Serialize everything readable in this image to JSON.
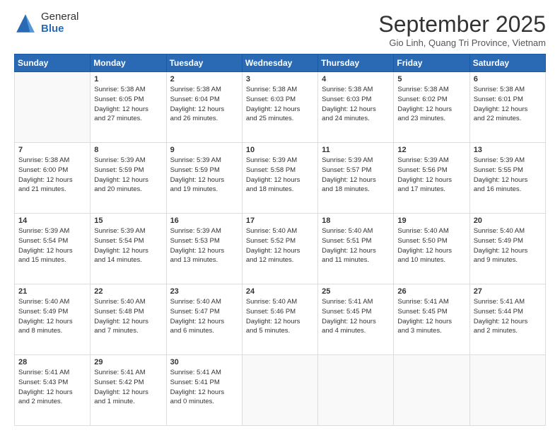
{
  "logo": {
    "general": "General",
    "blue": "Blue"
  },
  "header": {
    "title": "September 2025",
    "subtitle": "Gio Linh, Quang Tri Province, Vietnam"
  },
  "days": [
    "Sunday",
    "Monday",
    "Tuesday",
    "Wednesday",
    "Thursday",
    "Friday",
    "Saturday"
  ],
  "weeks": [
    [
      {
        "num": "",
        "info": ""
      },
      {
        "num": "1",
        "info": "Sunrise: 5:38 AM\nSunset: 6:05 PM\nDaylight: 12 hours\nand 27 minutes."
      },
      {
        "num": "2",
        "info": "Sunrise: 5:38 AM\nSunset: 6:04 PM\nDaylight: 12 hours\nand 26 minutes."
      },
      {
        "num": "3",
        "info": "Sunrise: 5:38 AM\nSunset: 6:03 PM\nDaylight: 12 hours\nand 25 minutes."
      },
      {
        "num": "4",
        "info": "Sunrise: 5:38 AM\nSunset: 6:03 PM\nDaylight: 12 hours\nand 24 minutes."
      },
      {
        "num": "5",
        "info": "Sunrise: 5:38 AM\nSunset: 6:02 PM\nDaylight: 12 hours\nand 23 minutes."
      },
      {
        "num": "6",
        "info": "Sunrise: 5:38 AM\nSunset: 6:01 PM\nDaylight: 12 hours\nand 22 minutes."
      }
    ],
    [
      {
        "num": "7",
        "info": "Sunrise: 5:38 AM\nSunset: 6:00 PM\nDaylight: 12 hours\nand 21 minutes."
      },
      {
        "num": "8",
        "info": "Sunrise: 5:39 AM\nSunset: 5:59 PM\nDaylight: 12 hours\nand 20 minutes."
      },
      {
        "num": "9",
        "info": "Sunrise: 5:39 AM\nSunset: 5:59 PM\nDaylight: 12 hours\nand 19 minutes."
      },
      {
        "num": "10",
        "info": "Sunrise: 5:39 AM\nSunset: 5:58 PM\nDaylight: 12 hours\nand 18 minutes."
      },
      {
        "num": "11",
        "info": "Sunrise: 5:39 AM\nSunset: 5:57 PM\nDaylight: 12 hours\nand 18 minutes."
      },
      {
        "num": "12",
        "info": "Sunrise: 5:39 AM\nSunset: 5:56 PM\nDaylight: 12 hours\nand 17 minutes."
      },
      {
        "num": "13",
        "info": "Sunrise: 5:39 AM\nSunset: 5:55 PM\nDaylight: 12 hours\nand 16 minutes."
      }
    ],
    [
      {
        "num": "14",
        "info": "Sunrise: 5:39 AM\nSunset: 5:54 PM\nDaylight: 12 hours\nand 15 minutes."
      },
      {
        "num": "15",
        "info": "Sunrise: 5:39 AM\nSunset: 5:54 PM\nDaylight: 12 hours\nand 14 minutes."
      },
      {
        "num": "16",
        "info": "Sunrise: 5:39 AM\nSunset: 5:53 PM\nDaylight: 12 hours\nand 13 minutes."
      },
      {
        "num": "17",
        "info": "Sunrise: 5:40 AM\nSunset: 5:52 PM\nDaylight: 12 hours\nand 12 minutes."
      },
      {
        "num": "18",
        "info": "Sunrise: 5:40 AM\nSunset: 5:51 PM\nDaylight: 12 hours\nand 11 minutes."
      },
      {
        "num": "19",
        "info": "Sunrise: 5:40 AM\nSunset: 5:50 PM\nDaylight: 12 hours\nand 10 minutes."
      },
      {
        "num": "20",
        "info": "Sunrise: 5:40 AM\nSunset: 5:49 PM\nDaylight: 12 hours\nand 9 minutes."
      }
    ],
    [
      {
        "num": "21",
        "info": "Sunrise: 5:40 AM\nSunset: 5:49 PM\nDaylight: 12 hours\nand 8 minutes."
      },
      {
        "num": "22",
        "info": "Sunrise: 5:40 AM\nSunset: 5:48 PM\nDaylight: 12 hours\nand 7 minutes."
      },
      {
        "num": "23",
        "info": "Sunrise: 5:40 AM\nSunset: 5:47 PM\nDaylight: 12 hours\nand 6 minutes."
      },
      {
        "num": "24",
        "info": "Sunrise: 5:40 AM\nSunset: 5:46 PM\nDaylight: 12 hours\nand 5 minutes."
      },
      {
        "num": "25",
        "info": "Sunrise: 5:41 AM\nSunset: 5:45 PM\nDaylight: 12 hours\nand 4 minutes."
      },
      {
        "num": "26",
        "info": "Sunrise: 5:41 AM\nSunset: 5:45 PM\nDaylight: 12 hours\nand 3 minutes."
      },
      {
        "num": "27",
        "info": "Sunrise: 5:41 AM\nSunset: 5:44 PM\nDaylight: 12 hours\nand 2 minutes."
      }
    ],
    [
      {
        "num": "28",
        "info": "Sunrise: 5:41 AM\nSunset: 5:43 PM\nDaylight: 12 hours\nand 2 minutes."
      },
      {
        "num": "29",
        "info": "Sunrise: 5:41 AM\nSunset: 5:42 PM\nDaylight: 12 hours\nand 1 minute."
      },
      {
        "num": "30",
        "info": "Sunrise: 5:41 AM\nSunset: 5:41 PM\nDaylight: 12 hours\nand 0 minutes."
      },
      {
        "num": "",
        "info": ""
      },
      {
        "num": "",
        "info": ""
      },
      {
        "num": "",
        "info": ""
      },
      {
        "num": "",
        "info": ""
      }
    ]
  ]
}
